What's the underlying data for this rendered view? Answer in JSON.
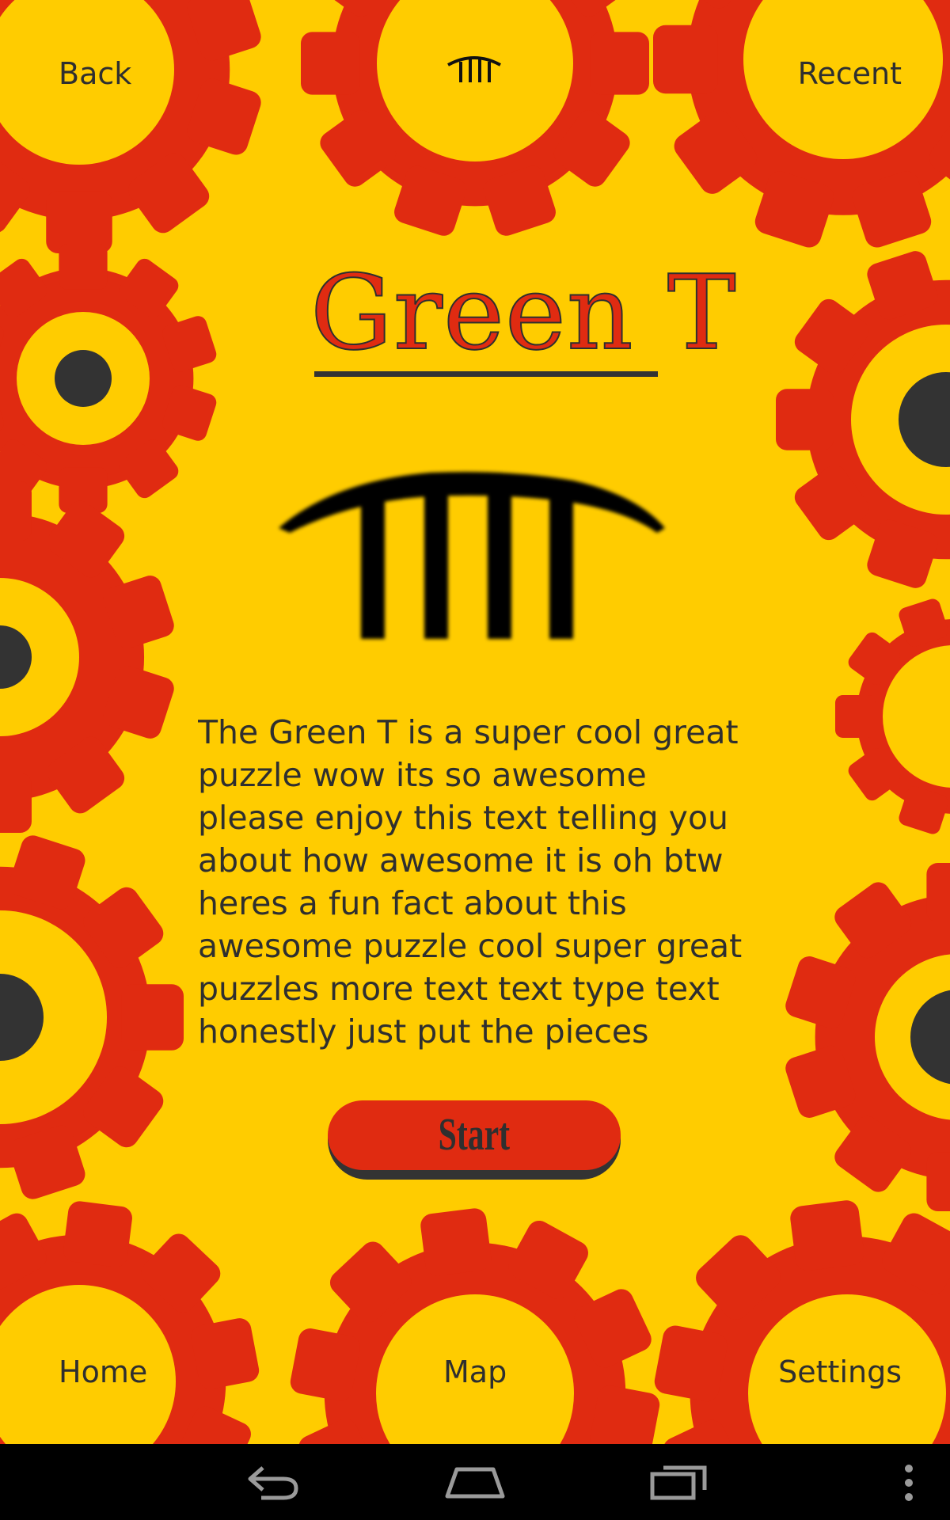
{
  "colors": {
    "background": "#ffcc00",
    "gear": "#e02b11",
    "dark": "#333333",
    "text": "#2f2f2f",
    "nav_bar": "#000000"
  },
  "top_bar": {
    "back_label": "Back",
    "recent_label": "Recent",
    "logo_icon": "bridge-arch-icon"
  },
  "puzzle": {
    "title": "Green T",
    "icon": "bridge-arch-icon",
    "description": " The Green T is a super cool great puzzle wow its so awesome please enjoy this text telling you about how awesome it is oh btw heres a fun fact about this awesome puzzle cool super great puzzles more text text type text honestly just put the pieces",
    "start_label": "Start"
  },
  "bottom_bar": {
    "home_label": "Home",
    "map_label": "Map",
    "settings_label": "Settings"
  },
  "system_nav": {
    "icons": [
      "back-arrow-icon",
      "home-outline-icon",
      "recent-apps-icon",
      "overflow-menu-icon"
    ]
  }
}
